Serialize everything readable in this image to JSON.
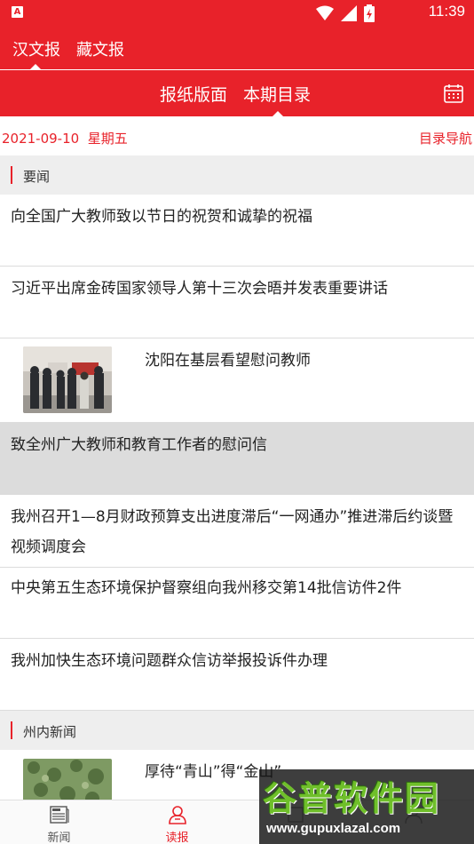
{
  "status_bar": {
    "app_badge": "A",
    "time": "11:39",
    "icons": [
      "wifi-icon",
      "signal-icon",
      "battery-icon"
    ]
  },
  "top_tabs": [
    {
      "label": "汉文报",
      "active": true
    },
    {
      "label": "藏文报",
      "active": false
    }
  ],
  "sub_tabs": [
    {
      "label": "报纸版面",
      "active": false
    },
    {
      "label": "本期目录",
      "active": true
    }
  ],
  "calendar_icon": "calendar-icon",
  "date_bar": {
    "date": "2021-09-10  星期五",
    "nav_link": "目录导航"
  },
  "sections": [
    {
      "title": "要闻",
      "items": [
        {
          "title": "向全国广大教师致以节日的祝贺和诚挚的祝福"
        },
        {
          "title": "习近平出席金砖国家领导人第十三次会晤并发表重要讲话"
        },
        {
          "title": "沈阳在基层看望慰问教师",
          "has_image": true
        },
        {
          "title": "致全州广大教师和教育工作者的慰问信",
          "highlighted": true
        },
        {
          "title": "我州召开1—8月财政预算支出进度滞后“一网通办”推进滞后约谈暨视频调度会"
        },
        {
          "title": "中央第五生态环境保护督察组向我州移交第14批信访件2件"
        },
        {
          "title": "我州加快生态环境问题群众信访举报投诉件办理"
        }
      ]
    },
    {
      "title": "州内新闻",
      "items": [
        {
          "title": "厚待“青山”得“金山”",
          "has_image": true
        }
      ]
    }
  ],
  "bottom_tabs": [
    {
      "label": "新闻",
      "icon": "newspaper-icon"
    },
    {
      "label": "读报",
      "icon": "reader-icon",
      "active": true
    },
    {
      "label": "",
      "icon": "third-tab-icon"
    },
    {
      "label": "",
      "icon": "profile-icon"
    }
  ],
  "watermark": {
    "logo": "谷普软件园",
    "url": "www.gupuxlazal.com"
  },
  "colors": {
    "brand_red": "#e8222a",
    "section_bg": "#eeeeee",
    "highlight_bg": "#dcdcdc"
  }
}
